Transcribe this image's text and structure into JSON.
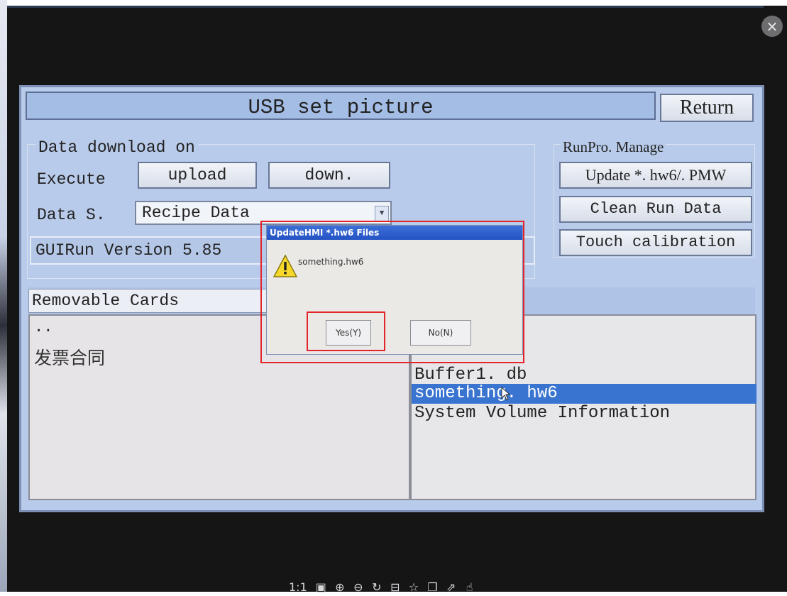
{
  "viewer": {
    "close_glyph": "×",
    "toolbar": {
      "zoom_label": "1:1",
      "icons": [
        "fit-window-icon",
        "zoom-in-icon",
        "zoom-out-icon",
        "rotate-icon",
        "save-icon",
        "bookmark-icon",
        "copy-icon",
        "share-icon",
        "like-icon"
      ]
    }
  },
  "hmi": {
    "title": "USB set picture",
    "return_label": "Return",
    "data_download_label": "Data download on",
    "execute_label": "Execute",
    "upload_label": "upload",
    "down_label": "down.",
    "data_s_label": "Data S.",
    "recipe_select_value": "Recipe Data",
    "gui_version": "GUIRun Version 5.85",
    "runpro_label": "RunPro. Manage",
    "update_label": "Update *. hw6/. PMW",
    "clean_label": "Clean Run Data",
    "touch_label": "Touch calibration",
    "removable_label": "Removable Cards",
    "left_pane": {
      "parent_dir": "..",
      "folder": "发票合同"
    },
    "right_pane": {
      "files": [
        "Buffer1. db",
        "something. hw6",
        "System Volume Information"
      ],
      "selected_index": 1
    }
  },
  "dialog": {
    "title": "UpdateHMI *.hw6 Files",
    "message": "something.hw6",
    "yes_label": "Yes(Y)",
    "no_label": "No(N)"
  },
  "colors": {
    "hmi_background": "#b8cbea",
    "selection": "#3a74d1",
    "annotation_red": "#e3242b",
    "dialog_title": "#2452c3"
  }
}
